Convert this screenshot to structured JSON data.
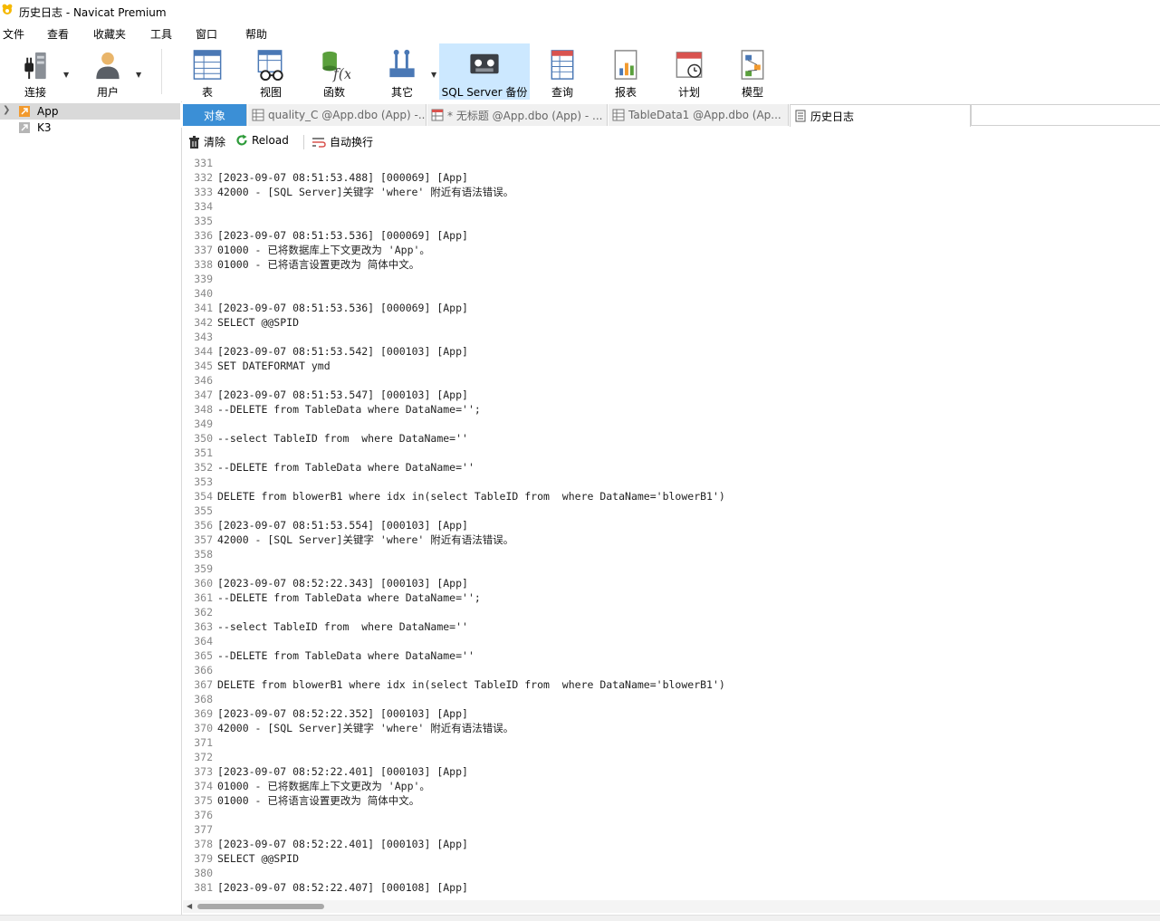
{
  "window": {
    "title": "历史日志 - Navicat Premium"
  },
  "menu": [
    {
      "label": "文件"
    },
    {
      "label": "查看"
    },
    {
      "label": "收藏夹"
    },
    {
      "label": "工具"
    },
    {
      "label": "窗口"
    },
    {
      "label": "帮助"
    }
  ],
  "toolbar": [
    {
      "label": "连接",
      "icon": "connection-plug-icon",
      "dropdown": true
    },
    {
      "label": "用户",
      "icon": "user-icon",
      "dropdown": true
    },
    {
      "label": "表",
      "icon": "table-icon"
    },
    {
      "label": "视图",
      "icon": "view-glasses-icon"
    },
    {
      "label": "函数",
      "icon": "function-icon"
    },
    {
      "label": "其它",
      "icon": "tools-icon",
      "dropdown": true
    },
    {
      "label": "SQL Server 备份",
      "icon": "backup-tape-icon",
      "active": true
    },
    {
      "label": "查询",
      "icon": "query-icon"
    },
    {
      "label": "报表",
      "icon": "report-icon"
    },
    {
      "label": "计划",
      "icon": "schedule-calendar-icon"
    },
    {
      "label": "模型",
      "icon": "model-icon"
    }
  ],
  "sidebar": {
    "items": [
      {
        "label": "App",
        "icon": "sql-server-connection-icon",
        "selected": true,
        "expandable": true
      },
      {
        "label": "K3",
        "icon": "sql-server-connection-icon",
        "selected": false,
        "expandable": false
      }
    ]
  },
  "tabs": [
    {
      "label": "对象",
      "type": "objects"
    },
    {
      "label": "quality_C @App.dbo (App) -...",
      "icon": "table-icon"
    },
    {
      "label": "* 无标题 @App.dbo (App) - ...",
      "icon": "query-icon"
    },
    {
      "label": "TableData1 @App.dbo (Ap...",
      "icon": "table-icon"
    },
    {
      "label": "历史日志",
      "icon": "history-log-icon",
      "active": true
    }
  ],
  "actions": {
    "clear": "清除",
    "reload": "Reload",
    "wrap": "自动换行"
  },
  "log_lines": [
    {
      "n": "331",
      "t": ""
    },
    {
      "n": "332",
      "t": "[2023-09-07 08:51:53.488] [000069] [App]"
    },
    {
      "n": "333",
      "t": "42000 - [SQL Server]关键字 'where' 附近有语法错误。"
    },
    {
      "n": "334",
      "t": ""
    },
    {
      "n": "335",
      "t": ""
    },
    {
      "n": "336",
      "t": "[2023-09-07 08:51:53.536] [000069] [App]"
    },
    {
      "n": "337",
      "t": "01000 - 已将数据库上下文更改为 'App'。"
    },
    {
      "n": "338",
      "t": "01000 - 已将语言设置更改为 简体中文。"
    },
    {
      "n": "339",
      "t": ""
    },
    {
      "n": "340",
      "t": ""
    },
    {
      "n": "341",
      "t": "[2023-09-07 08:51:53.536] [000069] [App]"
    },
    {
      "n": "342",
      "t": "SELECT @@SPID"
    },
    {
      "n": "343",
      "t": ""
    },
    {
      "n": "344",
      "t": "[2023-09-07 08:51:53.542] [000103] [App]"
    },
    {
      "n": "345",
      "t": "SET DATEFORMAT ymd"
    },
    {
      "n": "346",
      "t": ""
    },
    {
      "n": "347",
      "t": "[2023-09-07 08:51:53.547] [000103] [App]"
    },
    {
      "n": "348",
      "t": "--DELETE from TableData where DataName='';"
    },
    {
      "n": "349",
      "t": ""
    },
    {
      "n": "350",
      "t": "--select TableID from  where DataName=''"
    },
    {
      "n": "351",
      "t": ""
    },
    {
      "n": "352",
      "t": "--DELETE from TableData where DataName=''"
    },
    {
      "n": "353",
      "t": ""
    },
    {
      "n": "354",
      "t": "DELETE from blowerB1 where idx in(select TableID from  where DataName='blowerB1')"
    },
    {
      "n": "355",
      "t": ""
    },
    {
      "n": "356",
      "t": "[2023-09-07 08:51:53.554] [000103] [App]"
    },
    {
      "n": "357",
      "t": "42000 - [SQL Server]关键字 'where' 附近有语法错误。"
    },
    {
      "n": "358",
      "t": ""
    },
    {
      "n": "359",
      "t": ""
    },
    {
      "n": "360",
      "t": "[2023-09-07 08:52:22.343] [000103] [App]"
    },
    {
      "n": "361",
      "t": "--DELETE from TableData where DataName='';"
    },
    {
      "n": "362",
      "t": ""
    },
    {
      "n": "363",
      "t": "--select TableID from  where DataName=''"
    },
    {
      "n": "364",
      "t": ""
    },
    {
      "n": "365",
      "t": "--DELETE from TableData where DataName=''"
    },
    {
      "n": "366",
      "t": ""
    },
    {
      "n": "367",
      "t": "DELETE from blowerB1 where idx in(select TableID from  where DataName='blowerB1')"
    },
    {
      "n": "368",
      "t": ""
    },
    {
      "n": "369",
      "t": "[2023-09-07 08:52:22.352] [000103] [App]"
    },
    {
      "n": "370",
      "t": "42000 - [SQL Server]关键字 'where' 附近有语法错误。"
    },
    {
      "n": "371",
      "t": ""
    },
    {
      "n": "372",
      "t": ""
    },
    {
      "n": "373",
      "t": "[2023-09-07 08:52:22.401] [000103] [App]"
    },
    {
      "n": "374",
      "t": "01000 - 已将数据库上下文更改为 'App'。"
    },
    {
      "n": "375",
      "t": "01000 - 已将语言设置更改为 简体中文。"
    },
    {
      "n": "376",
      "t": ""
    },
    {
      "n": "377",
      "t": ""
    },
    {
      "n": "378",
      "t": "[2023-09-07 08:52:22.401] [000103] [App]"
    },
    {
      "n": "379",
      "t": "SELECT @@SPID"
    },
    {
      "n": "380",
      "t": ""
    },
    {
      "n": "381",
      "t": "[2023-09-07 08:52:22.407] [000108] [App]"
    }
  ],
  "colors": {
    "active_tab": "#3b8fd6",
    "active_tool": "#cce8ff",
    "selected_row": "#d9d9d9",
    "reload_green": "#2e9b3a",
    "app_orange": "#f29a2e"
  }
}
